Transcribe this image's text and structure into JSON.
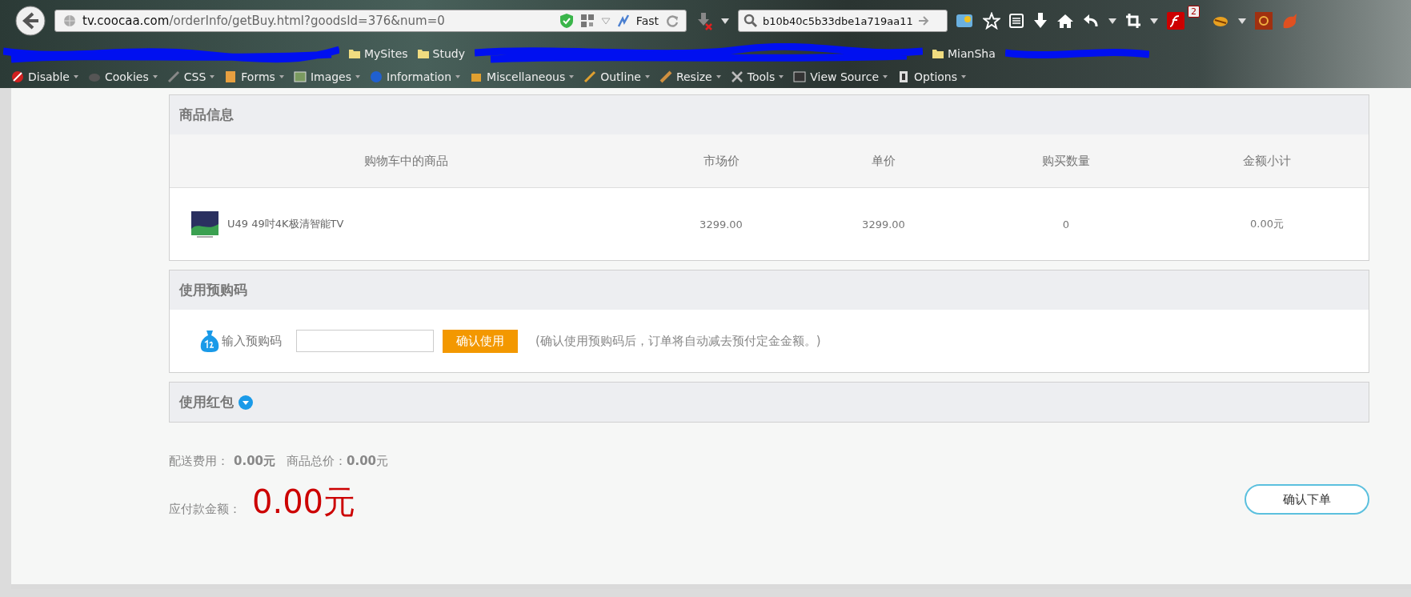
{
  "browser": {
    "address": {
      "host": "tv.coocaa.com",
      "path": "/orderInfo/getBuy.html?goodsId=376&num=0"
    },
    "speed_label": "Fast",
    "search_text": "b10b40c5b33dbe1a719aa11",
    "notification_count": "2",
    "bookmarks": [
      "MySites",
      "Study",
      "MianSha"
    ],
    "dev_menus": [
      "Disable",
      "Cookies",
      "CSS",
      "Forms",
      "Images",
      "Information",
      "Miscellaneous",
      "Outline",
      "Resize",
      "Tools",
      "View Source",
      "Options"
    ]
  },
  "goods": {
    "title": "商品信息",
    "columns": [
      "购物车中的商品",
      "市场价",
      "单价",
      "购买数量",
      "金额小计"
    ],
    "rows": [
      {
        "name": "U49 49吋4K极清智能TV",
        "market_price": "3299.00",
        "unit_price": "3299.00",
        "quantity": "0",
        "subtotal": "0.00元"
      }
    ]
  },
  "precode": {
    "title": "使用预购码",
    "label": "输入预购码",
    "button": "确认使用",
    "note": "(确认使用预购码后，订单将自动减去预付定金金额。)"
  },
  "red_packet": {
    "title": "使用红包",
    "expanded": false
  },
  "summary": {
    "shipping_label": "配送费用：",
    "shipping_value": "0.00元",
    "total_label": "商品总价：",
    "total_value": "0.00",
    "total_unit": "元",
    "payable_label": "应付款金额：",
    "payable_value": "0.00元",
    "submit": "确认下单"
  }
}
